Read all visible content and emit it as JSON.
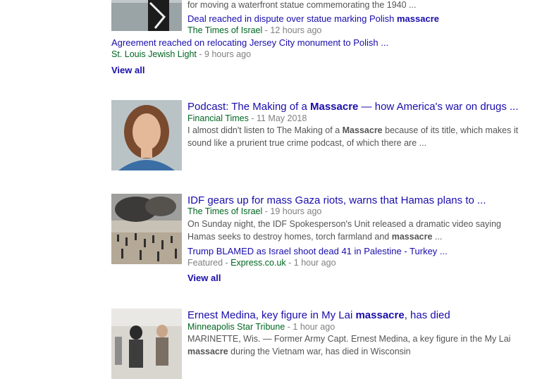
{
  "r1": {
    "snippet_tail": "for moving a waterfront statue commemorating the 1940 ...",
    "sub1_title_pre": "Deal reached in dispute over statue marking Polish ",
    "sub1_title_bold": "massacre",
    "sub1_source": "The Times of Israel",
    "sub1_time": "12 hours ago",
    "sub2_title": "Agreement reached on relocating Jersey City monument to Polish ...",
    "sub2_source": "St. Louis Jewish Light",
    "sub2_time": "9 hours ago",
    "view_all": "View all"
  },
  "r2": {
    "title_pre": "Podcast: The Making of a ",
    "title_bold": "Massacre",
    "title_post": " — how America's war on drugs ...",
    "source": "Financial Times",
    "time": "11 May 2018",
    "snip1_pre": "I almost didn't listen to The Making of a ",
    "snip1_bold": "Massacre",
    "snip1_post": " because of its title, which makes it",
    "snip2": "sound like a prurient true crime podcast, of which there are ..."
  },
  "r3": {
    "title": "IDF gears up for mass Gaza riots, warns that Hamas plans to ...",
    "source": "The Times of Israel",
    "time": "19 hours ago",
    "snip1": "On Sunday night, the IDF Spokesperson's Unit released a dramatic video saying",
    "snip2_pre": "Hamas seeks to destroy homes, torch farmland and ",
    "snip2_bold": "massacre",
    "snip2_post": " ...",
    "sub_title": "Trump BLAMED as Israel shoot dead 41 in Palestine - Turkey ...",
    "sub_label": "Featured",
    "sub_source": "Express.co.uk",
    "sub_time": "1 hour ago",
    "view_all": "View all"
  },
  "r4": {
    "title_pre": "Ernest Medina, key figure in My Lai ",
    "title_bold": "massacre",
    "title_post": ", has died",
    "source": "Minneapolis Star Tribune",
    "time": "1 hour ago",
    "snip1": "MARINETTE, Wis. — Former Army Capt. Ernest Medina, a key figure in the My Lai",
    "snip2_bold": "massacre",
    "snip2_post": " during the Vietnam war, has died in Wisconsin"
  },
  "sep": " - "
}
